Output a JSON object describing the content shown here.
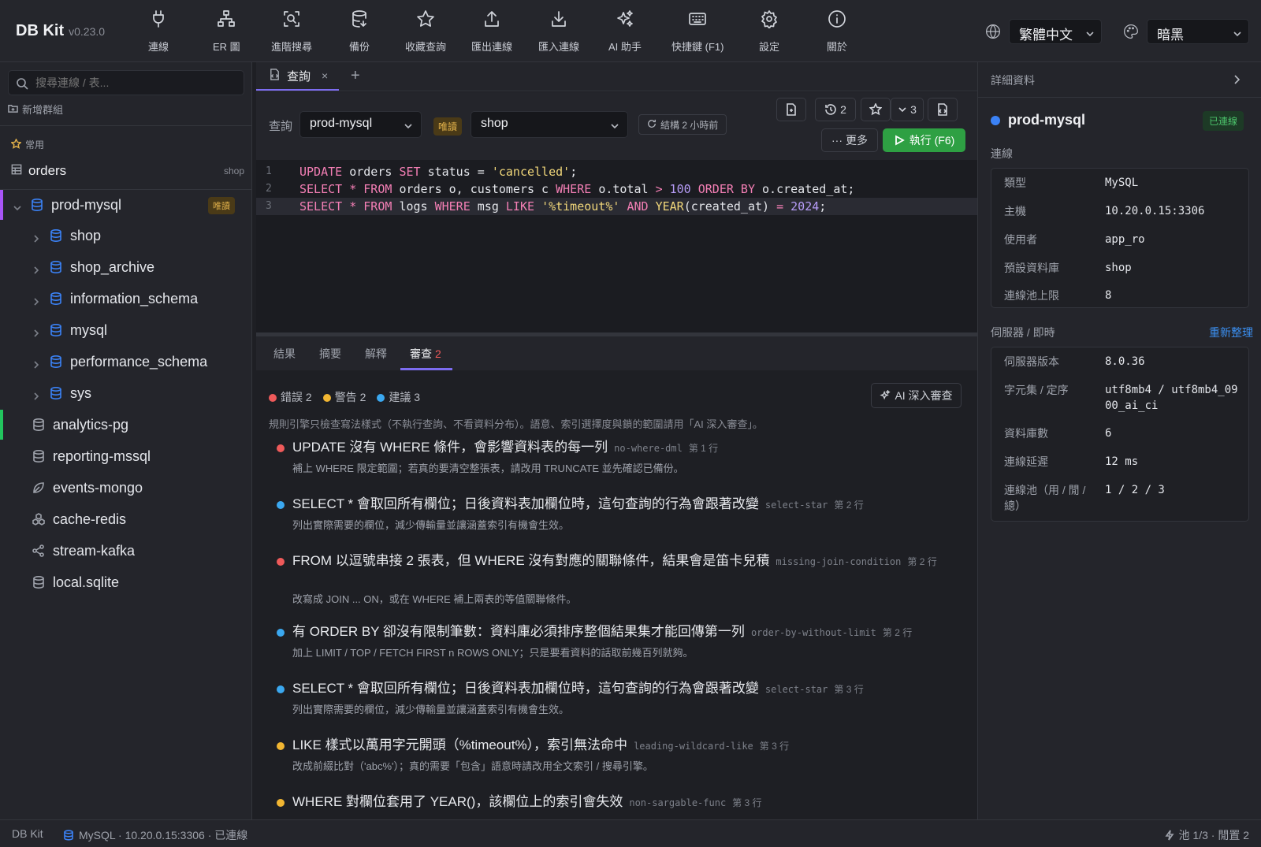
{
  "app": {
    "name": "DB Kit",
    "version": "v0.23.0"
  },
  "toolbar": {
    "items": [
      {
        "label": "連線",
        "icon": "plug-icon"
      },
      {
        "label": "ER 圖",
        "icon": "er-diagram-icon"
      },
      {
        "label": "進階搜尋",
        "icon": "advanced-search-icon"
      },
      {
        "label": "備份",
        "icon": "backup-icon"
      },
      {
        "label": "收藏查詢",
        "icon": "star-icon"
      },
      {
        "label": "匯出連線",
        "icon": "export-icon"
      },
      {
        "label": "匯入連線",
        "icon": "import-icon"
      },
      {
        "label": "AI 助手",
        "icon": "ai-sparkle-icon"
      },
      {
        "label": "快捷鍵 (F1)",
        "icon": "keyboard-icon"
      },
      {
        "label": "設定",
        "icon": "gear-icon"
      },
      {
        "label": "關於",
        "icon": "info-icon"
      }
    ],
    "language": "繁體中文",
    "theme": "暗黑"
  },
  "sidebar": {
    "search_placeholder": "搜尋連線 / 表...",
    "new_group": "新增群組",
    "favorites_title": "常用",
    "favorite": {
      "name": "orders",
      "db": "shop"
    },
    "connections": [
      {
        "name": "prod-mysql",
        "badge": "唯讀",
        "color": "#a855f7",
        "expanded": true,
        "children": [
          "shop",
          "shop_archive",
          "information_schema",
          "mysql",
          "performance_schema",
          "sys"
        ]
      },
      {
        "name": "analytics-pg",
        "color": "#22c55e"
      },
      {
        "name": "reporting-mssql"
      },
      {
        "name": "events-mongo"
      },
      {
        "name": "cache-redis"
      },
      {
        "name": "stream-kafka"
      },
      {
        "name": "local.sqlite"
      }
    ]
  },
  "tabs": {
    "query_tab": "查詢",
    "close": "×",
    "add": "+"
  },
  "query_bar": {
    "label": "查詢",
    "connection": "prod-mysql",
    "readonly_badge": "唯讀",
    "database": "shop",
    "schema_status": "結構 2 小時前",
    "history_count": "2",
    "favorites_count": "3",
    "more": "更多",
    "run": "執行 (F6)"
  },
  "editor": {
    "lines": [
      {
        "n": "1"
      },
      {
        "n": "2"
      },
      {
        "n": "3"
      }
    ],
    "tokens": {
      "update": "UPDATE",
      "orders": "orders",
      "set": "SET",
      "status_eq": "status =",
      "cancelled": "'cancelled'",
      "semi": ";",
      "select": "SELECT",
      "star_from": "*",
      "from": "FROM",
      "tbl2": "orders o, customers c",
      "where": "WHERE",
      "cond2a": "o.total",
      "gt": ">",
      "hundred": "100",
      "orderby": "ORDER BY",
      "col2": "o.created_at;",
      "logs": "logs",
      "msg": "msg",
      "like": "LIKE",
      "pattern": "'%timeout%'",
      "and": "AND",
      "year": "YEAR",
      "yarg": "(created_at)",
      "eq": "=",
      "year_val": "2024",
      "semi3": ";"
    }
  },
  "result_tabs": {
    "results": "結果",
    "summary": "摘要",
    "explain": "解釋",
    "review": "審查",
    "review_count": "2"
  },
  "review": {
    "errors": "錯誤 2",
    "warnings": "警告 2",
    "suggestions": "建議 3",
    "ai_deep": "AI 深入審查",
    "note": "規則引擎只檢查寫法樣式（不執行查詢、不看資料分布）。語意、索引選擇度與鎖的範圍請用「AI 深入審查」。",
    "issues": [
      {
        "level": "error",
        "title": "UPDATE 沒有 WHERE 條件，會影響資料表的每一列",
        "rule": "no-where-dml",
        "line": "第 1 行",
        "hint": "補上 WHERE 限定範圍；若真的要清空整張表，請改用 TRUNCATE 並先確認已備份。"
      },
      {
        "level": "info",
        "title": "SELECT * 會取回所有欄位；日後資料表加欄位時，這句查詢的行為會跟著改變",
        "rule": "select-star",
        "line": "第 2 行",
        "hint": "列出實際需要的欄位，減少傳輸量並讓涵蓋索引有機會生效。"
      },
      {
        "level": "error",
        "title": "FROM 以逗號串接 2 張表，但 WHERE 沒有對應的關聯條件，結果會是笛卡兒積",
        "rule": "missing-join-condition",
        "line": "第 2 行",
        "hint": "改寫成 JOIN ... ON，或在 WHERE 補上兩表的等值關聯條件。"
      },
      {
        "level": "info",
        "title": "有 ORDER BY 卻沒有限制筆數：資料庫必須排序整個結果集才能回傳第一列",
        "rule": "order-by-without-limit",
        "line": "第 2 行",
        "hint": "加上 LIMIT / TOP / FETCH FIRST n ROWS ONLY；只是要看資料的話取前幾百列就夠。"
      },
      {
        "level": "info",
        "title": "SELECT * 會取回所有欄位；日後資料表加欄位時，這句查詢的行為會跟著改變",
        "rule": "select-star",
        "line": "第 3 行",
        "hint": "列出實際需要的欄位，減少傳輸量並讓涵蓋索引有機會生效。"
      },
      {
        "level": "warning",
        "title": "LIKE 樣式以萬用字元開頭（%timeout%），索引無法命中",
        "rule": "leading-wildcard-like",
        "line": "第 3 行",
        "hint": "改成前綴比對（'abc%'）；真的需要「包含」語意時請改用全文索引 / 搜尋引擎。"
      },
      {
        "level": "warning",
        "title": "WHERE 對欄位套用了 YEAR()，該欄位上的索引會失效",
        "rule": "non-sargable-func",
        "line": "第 3 行",
        "hint": ""
      }
    ],
    "colors": {
      "error": "#ef5a5a",
      "warning": "#f2b632",
      "info": "#3ba8f0"
    }
  },
  "details": {
    "title": "詳細資料",
    "name": "prod-mysql",
    "status": "已連線",
    "conn_section": "連線",
    "conn": [
      {
        "k": "類型",
        "v": "MySQL"
      },
      {
        "k": "主機",
        "v": "10.20.0.15:3306"
      },
      {
        "k": "使用者",
        "v": "app_ro"
      },
      {
        "k": "預設資料庫",
        "v": "shop"
      },
      {
        "k": "連線池上限",
        "v": "8"
      }
    ],
    "server_section": "伺服器 / 即時",
    "refresh": "重新整理",
    "server": [
      {
        "k": "伺服器版本",
        "v": "8.0.36"
      },
      {
        "k": "字元集 / 定序",
        "v": "utf8mb4 / utf8mb4_0900_ai_ci"
      },
      {
        "k": "資料庫數",
        "v": "6"
      },
      {
        "k": "連線延遲",
        "v": "12 ms"
      },
      {
        "k": "連線池（用 / 閒 / 總）",
        "v": "1 / 2 / 3"
      }
    ]
  },
  "statusbar": {
    "app": "DB Kit",
    "conn": "MySQL · 10.20.0.15:3306 · 已連線",
    "pool": "池 1/3 · 閒置 2"
  }
}
